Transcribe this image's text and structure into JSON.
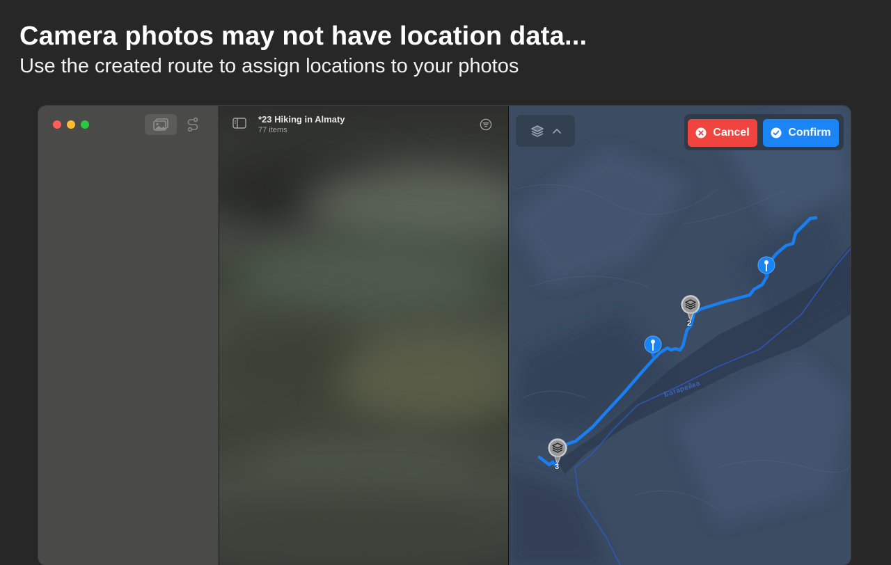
{
  "promo": {
    "headline": "Camera photos may not have location data...",
    "subline": "Use the created route to assign locations to your photos"
  },
  "sidebar": {
    "buttons": [
      {
        "icon": "photos-icon",
        "selected": true
      },
      {
        "icon": "routes-icon",
        "selected": false
      }
    ]
  },
  "album": {
    "title": "*23 Hiking in Almaty",
    "count": "77 items"
  },
  "map": {
    "river_label": "Батарейка",
    "markers": [
      {
        "type": "cluster",
        "count": "2"
      },
      {
        "type": "cluster",
        "count": "3"
      },
      {
        "type": "pin"
      },
      {
        "type": "pin"
      }
    ],
    "route_color": "#1a7ff0"
  },
  "actions": {
    "cancel_label": "Cancel",
    "confirm_label": "Confirm",
    "cancel_color": "#f0453f",
    "confirm_color": "#1b85f6"
  }
}
